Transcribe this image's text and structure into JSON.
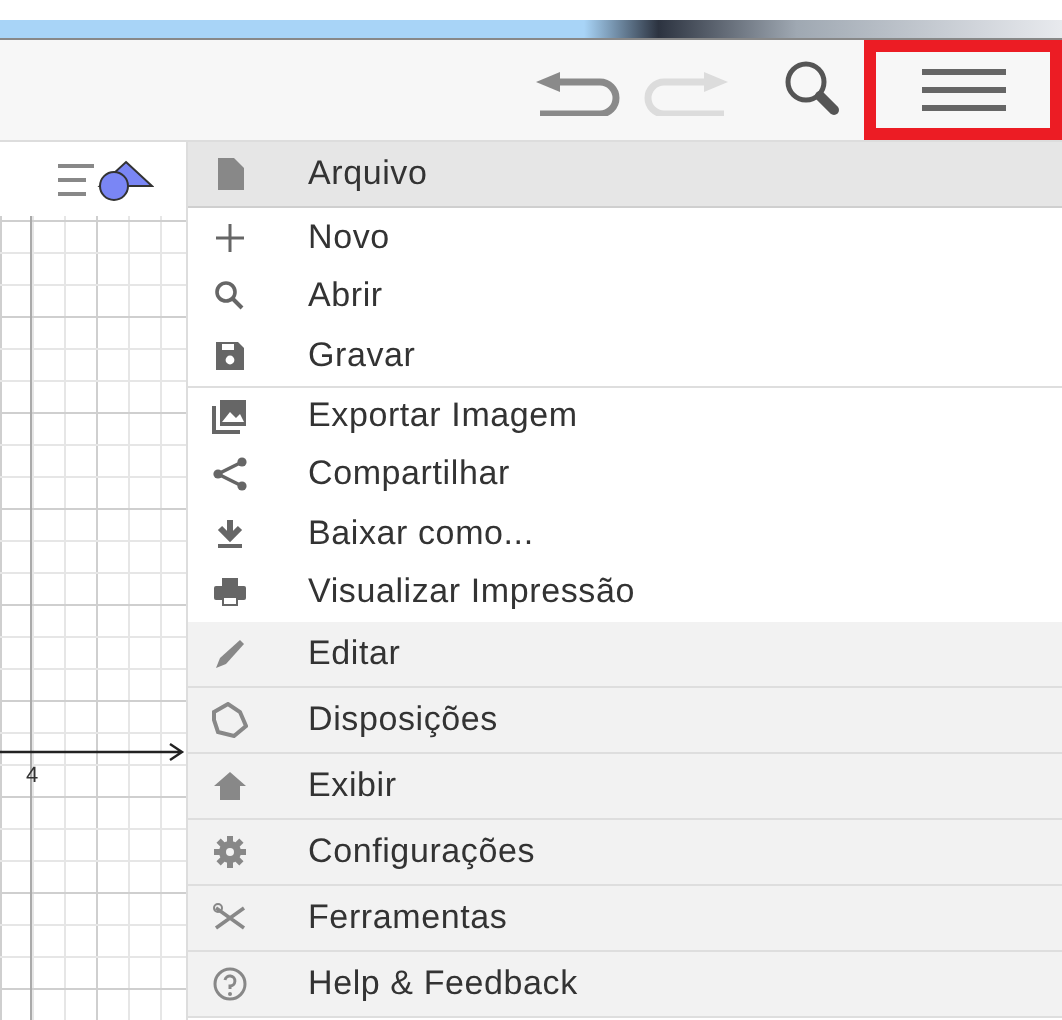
{
  "toolbar": {
    "undo": {
      "disabled": false
    },
    "redo": {
      "disabled": true
    },
    "menu_button": {
      "highlighted": true
    }
  },
  "graphics": {
    "axis_label": "4"
  },
  "menu": [
    {
      "label": "Arquivo",
      "expanded": true,
      "children": [
        {
          "label": "Novo"
        },
        {
          "label": "Abrir"
        },
        {
          "label": "Gravar"
        },
        {
          "label": "Exportar Imagem",
          "group_start": true
        },
        {
          "label": "Compartilhar"
        },
        {
          "label": "Baixar como..."
        },
        {
          "label": "Visualizar Impressão"
        }
      ]
    },
    {
      "label": "Editar",
      "expanded": false
    },
    {
      "label": "Disposições",
      "expanded": false
    },
    {
      "label": "Exibir",
      "expanded": false
    },
    {
      "label": "Configurações",
      "expanded": false
    },
    {
      "label": "Ferramentas",
      "expanded": false
    },
    {
      "label": "Help & Feedback",
      "expanded": false
    }
  ]
}
